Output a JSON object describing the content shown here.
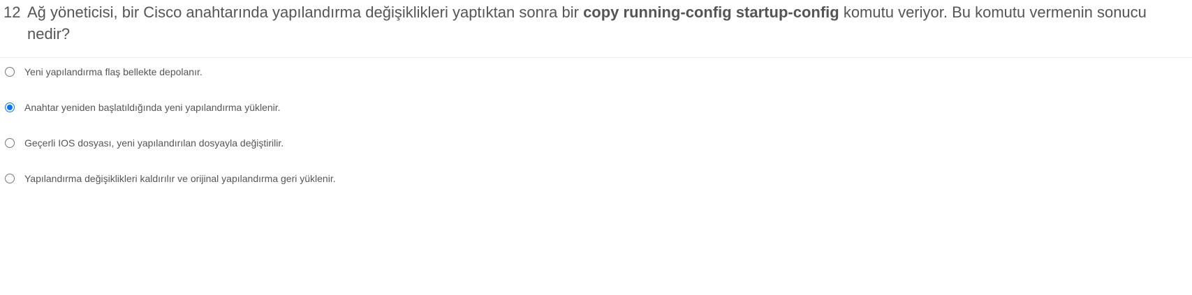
{
  "question": {
    "number": "12",
    "text_before": "Ağ yöneticisi, bir Cisco anahtarında yapılandırma değişiklikleri yaptıktan sonra bir ",
    "command": "copy running-config startup-config",
    "text_after": " komutu veriyor. Bu komutu vermenin sonucu nedir?"
  },
  "options": [
    {
      "label": "Yeni yapılandırma flaş bellekte depolanır.",
      "selected": false
    },
    {
      "label": "Anahtar yeniden başlatıldığında yeni yapılandırma yüklenir.",
      "selected": true
    },
    {
      "label": "Geçerli IOS dosyası, yeni yapılandırılan dosyayla değiştirilir.",
      "selected": false
    },
    {
      "label": "Yapılandırma değişiklikleri kaldırılır ve orijinal yapılandırma geri yüklenir.",
      "selected": false
    }
  ],
  "colors": {
    "text": "#555555",
    "radio_selected": "#0075ff",
    "divider": "#ececec"
  }
}
